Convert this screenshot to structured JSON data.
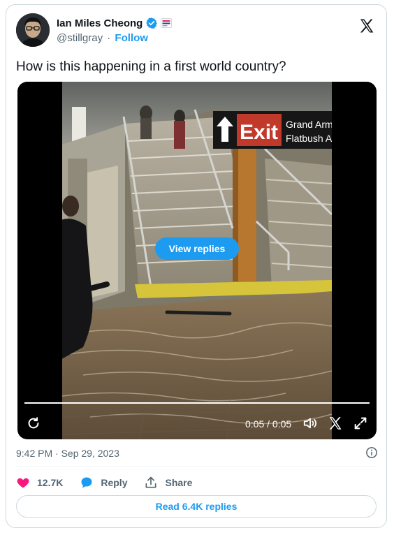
{
  "author": {
    "name": "Ian Miles Cheong",
    "handle": "@stillgray",
    "separator": "·",
    "follow_label": "Follow"
  },
  "tweet": {
    "text": "How is this happening in a first world country?"
  },
  "media": {
    "view_replies_label": "View replies",
    "time_display": "0:05 / 0:05",
    "progress": 1.0,
    "sign_text": {
      "exit": "Exit",
      "line1": "Grand Arm",
      "line2": "Flatbush A"
    }
  },
  "meta": {
    "timestamp": "9:42 PM · Sep 29, 2023"
  },
  "actions": {
    "like_count": "12.7K",
    "reply_label": "Reply",
    "share_label": "Share"
  },
  "footer": {
    "read_replies_label": "Read 6.4K replies"
  },
  "colors": {
    "accent": "#1d9bf0",
    "like": "#f91880",
    "text_primary": "#0f1419",
    "text_secondary": "#536471",
    "border": "#cfd9de"
  },
  "icons": {
    "verified": "verified-badge-icon",
    "affiliate": "affiliate-badge-icon",
    "x_logo": "x-logo-icon",
    "replay": "replay-icon",
    "volume": "volume-icon",
    "fullscreen": "fullscreen-icon",
    "info": "info-icon",
    "like": "heart-icon",
    "reply": "speech-bubble-icon",
    "share": "share-arrow-icon"
  }
}
